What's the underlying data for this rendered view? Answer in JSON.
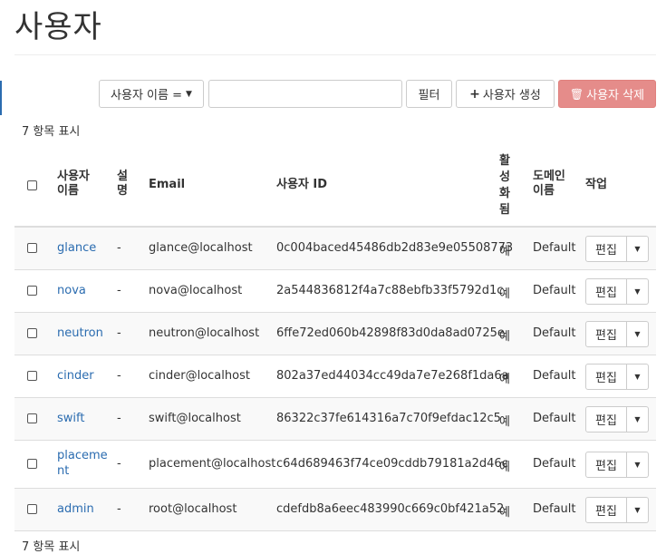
{
  "page": {
    "title": "사용자"
  },
  "toolbar": {
    "filter_field_label": "사용자 이름 =",
    "search_value": "",
    "filter_label": "필터",
    "create_label": "사용자 생성",
    "delete_label": "사용자 삭제"
  },
  "table": {
    "count_label": "7 항목 표시",
    "count_label_bottom": "7 항목 표시",
    "headers": {
      "name": [
        "사용자",
        "이름"
      ],
      "description": [
        "설",
        "명"
      ],
      "email": "Email",
      "user_id": "사용자 ID",
      "enabled": [
        "활",
        "성",
        "화",
        "됨"
      ],
      "domain": [
        "도메인",
        "이름"
      ],
      "actions": "작업"
    },
    "rows": [
      {
        "name": "glance",
        "description": "-",
        "email": "glance@localhost",
        "user_id": "0c004baced45486db2d83e9e05508773",
        "enabled": "예",
        "domain": "Default",
        "edit": "편집"
      },
      {
        "name": "nova",
        "description": "-",
        "email": "nova@localhost",
        "user_id": "2a544836812f4a7c88ebfb33f5792d1c",
        "enabled": "예",
        "domain": "Default",
        "edit": "편집"
      },
      {
        "name": "neutron",
        "description": "-",
        "email": "neutron@localhost",
        "user_id": "6ffe72ed060b42898f83d0da8ad0725e",
        "enabled": "예",
        "domain": "Default",
        "edit": "편집"
      },
      {
        "name": "cinder",
        "description": "-",
        "email": "cinder@localhost",
        "user_id": "802a37ed44034cc49da7e7e268f1da6a",
        "enabled": "예",
        "domain": "Default",
        "edit": "편집"
      },
      {
        "name": "swift",
        "description": "-",
        "email": "swift@localhost",
        "user_id": "86322c37fe614316a7c70f9efdac12c5",
        "enabled": "예",
        "domain": "Default",
        "edit": "편집"
      },
      {
        "name": "placement",
        "description": "-",
        "email": "placement@localhost",
        "user_id": "c64d689463f74ce09cddb79181a2d46c",
        "enabled": "예",
        "domain": "Default",
        "edit": "편집"
      },
      {
        "name": "admin",
        "description": "-",
        "email": "root@localhost",
        "user_id": "cdefdb8a6eec483990c669c0bf421a52",
        "enabled": "예",
        "domain": "Default",
        "edit": "편집"
      }
    ]
  },
  "icons": {
    "create": "plus-icon",
    "delete": "trash-icon",
    "dropdown": "caret-down-icon"
  },
  "colors": {
    "link": "#2b6cb0",
    "danger_button": "#e58c8a"
  }
}
